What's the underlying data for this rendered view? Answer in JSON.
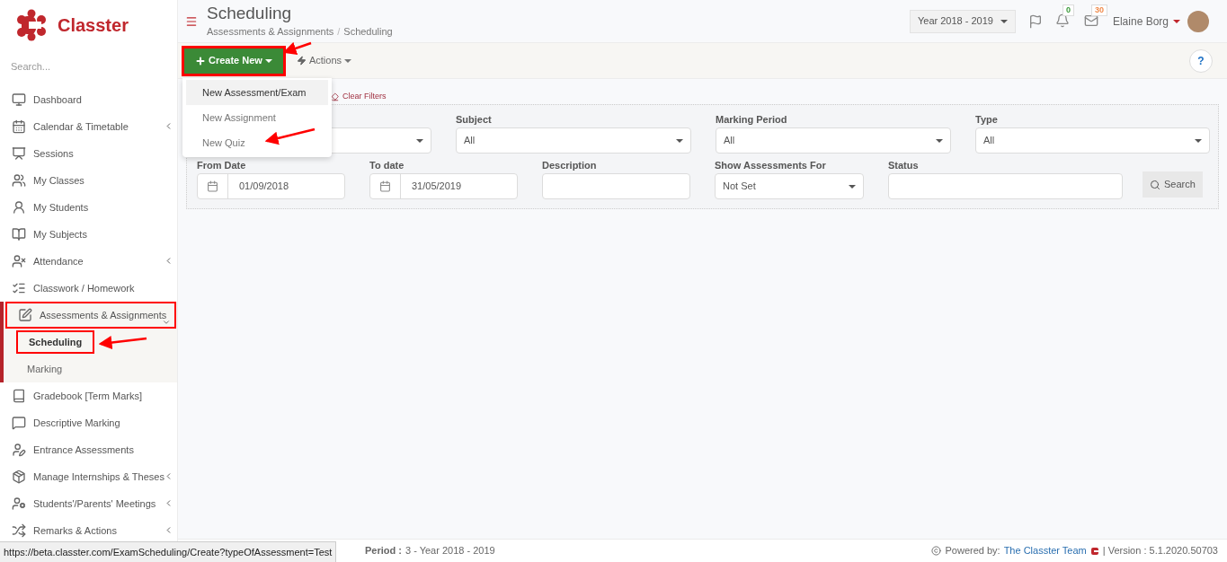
{
  "brand": {
    "name": "Classter"
  },
  "sidebar": {
    "search_placeholder": "Search...",
    "items": [
      {
        "label": "Dashboard",
        "expandable": false
      },
      {
        "label": "Calendar & Timetable",
        "expandable": true
      },
      {
        "label": "Sessions",
        "expandable": false
      },
      {
        "label": "My Classes",
        "expandable": false
      },
      {
        "label": "My Students",
        "expandable": false
      },
      {
        "label": "My Subjects",
        "expandable": false
      },
      {
        "label": "Attendance",
        "expandable": true
      },
      {
        "label": "Classwork / Homework",
        "expandable": false
      },
      {
        "label": "Assessments & Assignments",
        "expandable": true,
        "expanded": true,
        "children": [
          {
            "label": "Scheduling",
            "selected": true
          },
          {
            "label": "Marking",
            "selected": false
          }
        ]
      },
      {
        "label": "Gradebook [Term Marks]",
        "expandable": false
      },
      {
        "label": "Descriptive Marking",
        "expandable": false
      },
      {
        "label": "Entrance Assessments",
        "expandable": false
      },
      {
        "label": "Manage Internships & Theses",
        "expandable": true
      },
      {
        "label": "Students'/Parents' Meetings",
        "expandable": true
      },
      {
        "label": "Remarks & Actions",
        "expandable": true
      }
    ]
  },
  "header": {
    "title": "Scheduling",
    "breadcrumb": [
      "Assessments & Assignments",
      "Scheduling"
    ],
    "breadcrumb_separator": "/",
    "year": "Year 2018 - 2019",
    "notifications": "0",
    "messages": "30",
    "user": "Elaine Borg"
  },
  "toolbar": {
    "create_button": "Create New",
    "actions_button": "Actions",
    "help": "?"
  },
  "create_menu": [
    {
      "label": "New Assessment/Exam",
      "selected": true
    },
    {
      "label": "New Assignment",
      "selected": false
    },
    {
      "label": "New Quiz",
      "selected": false
    }
  ],
  "filters": {
    "clear": "Clear Filters",
    "row_1": [
      {
        "kind": "select"
      },
      {
        "label": "Subject",
        "value": "All",
        "kind": "select"
      },
      {
        "label": "Marking Period",
        "value": "All",
        "kind": "select"
      },
      {
        "label": "Type",
        "value": "All",
        "kind": "select"
      }
    ],
    "row_2": [
      {
        "label": "From Date",
        "value": "01/09/2018",
        "kind": "date"
      },
      {
        "label": "To date",
        "value": "31/05/2019",
        "kind": "date"
      },
      {
        "label": "Description",
        "kind": "text"
      },
      {
        "label": "Show Assessments For",
        "value": "Not Set",
        "kind": "select"
      },
      {
        "label": "Status",
        "kind": "text"
      }
    ],
    "search_button": "Search"
  },
  "footer": {
    "period_label": "Period :",
    "period_value": "3 - Year 2018 - 2019",
    "powered_by": "Powered by:",
    "team": "The Classter Team",
    "version": "| Version : 5.1.2020.50703"
  },
  "link_preview": "https://beta.classter.com/ExamScheduling/Create?typeOfAssessment=Test"
}
